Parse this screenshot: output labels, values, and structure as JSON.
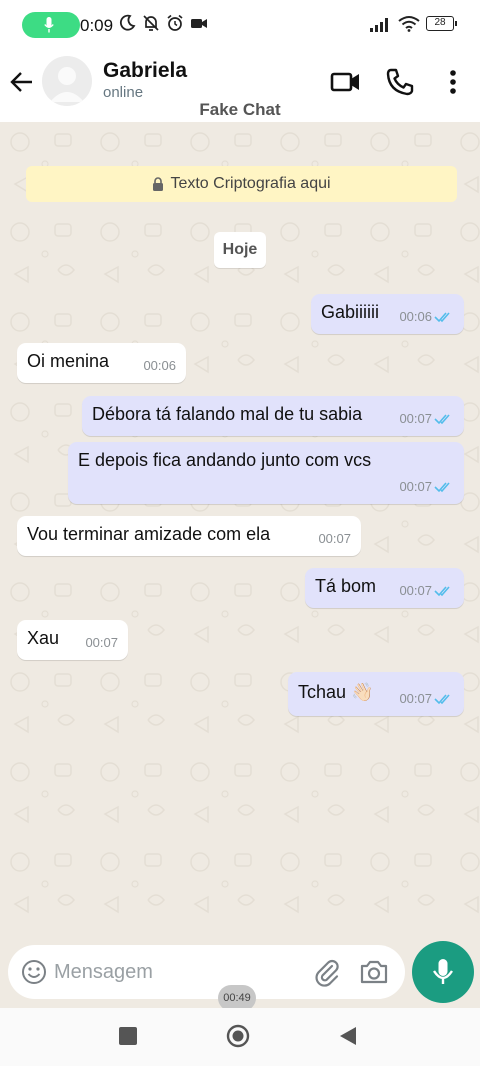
{
  "status_bar": {
    "time": "0:09",
    "battery": "28",
    "icons": [
      "mic-icon",
      "moon-icon",
      "bell-off-icon",
      "alarm-icon",
      "video-record-icon",
      "signal-icon",
      "wifi-icon",
      "battery-icon"
    ]
  },
  "header": {
    "contact_name": "Gabriela",
    "contact_status": "online",
    "app_title": "Fake Chat",
    "icons": [
      "back-arrow-icon",
      "video-call-icon",
      "phone-icon",
      "more-vert-icon"
    ]
  },
  "chat": {
    "encryption_notice": "Texto Criptografia aqui",
    "date_chip": "Hoje",
    "messages": [
      {
        "direction": "out",
        "text": "Gabiiiiii",
        "time": "00:06",
        "read": true
      },
      {
        "direction": "in",
        "text": "Oi menina",
        "time": "00:06"
      },
      {
        "direction": "out",
        "text": "Débora tá falando mal de tu sabia",
        "time": "00:07",
        "read": true
      },
      {
        "direction": "out",
        "text": "E depois fica andando junto com vcs",
        "time": "00:07",
        "read": true
      },
      {
        "direction": "in",
        "text": "Vou terminar amizade com ela",
        "time": "00:07"
      },
      {
        "direction": "out",
        "text": "Tá bom",
        "time": "00:07",
        "read": true
      },
      {
        "direction": "in",
        "text": "Xau",
        "time": "00:07"
      },
      {
        "direction": "out",
        "text": "Tchau 👋🏻",
        "time": "00:07",
        "read": true
      }
    ]
  },
  "composer": {
    "placeholder": "Mensagem",
    "icons": [
      "emoji-icon",
      "attach-icon",
      "camera-icon",
      "mic-icon"
    ]
  },
  "recording_timer": "00:49",
  "colors": {
    "outgoing_bubble": "#e1e2fb",
    "incoming_bubble": "#ffffff",
    "read_ticks": "#53bdeb",
    "accent": "#1b9c81",
    "encryption_banner": "#fff5c4",
    "chat_background": "#efeae2"
  }
}
